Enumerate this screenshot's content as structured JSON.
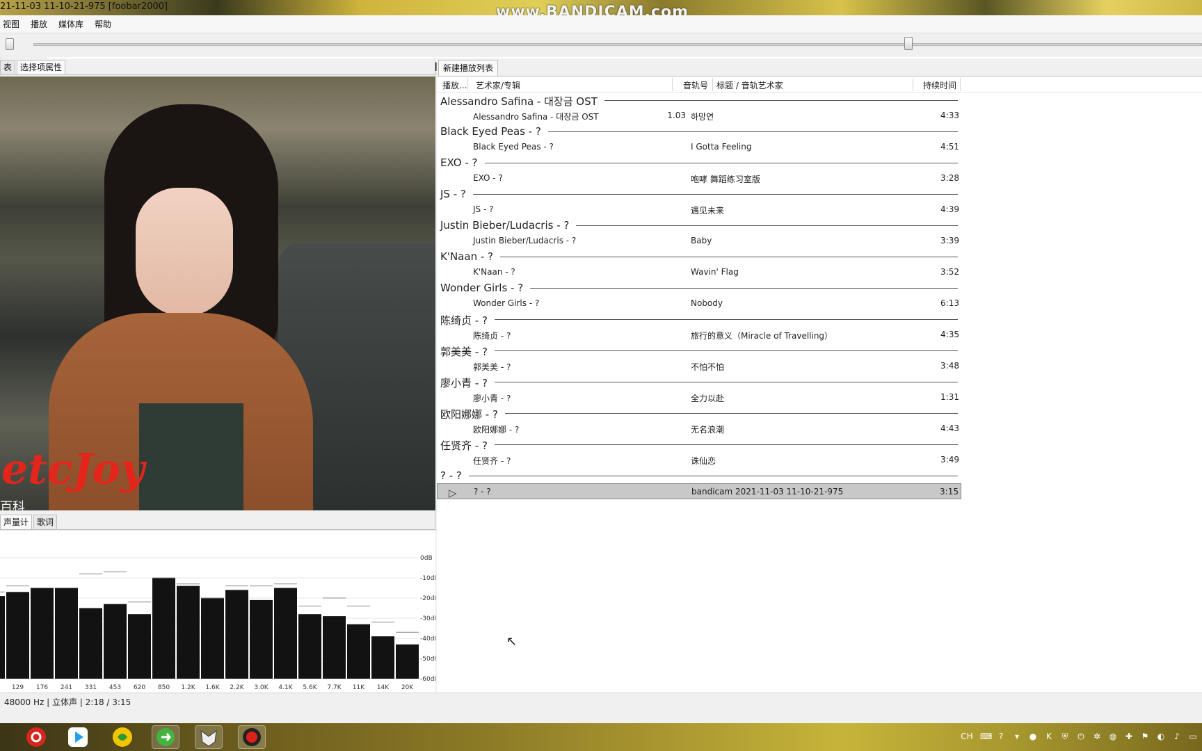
{
  "window": {
    "title": "21-11-03 11-10-21-975  [foobar2000]",
    "watermark": "www.BANDICAM.com"
  },
  "menu": [
    "视图",
    "播放",
    "媒体库",
    "帮助"
  ],
  "left_tabs": [
    "表",
    "选择项属性"
  ],
  "bottom_tabs": [
    "声量计",
    "歌词"
  ],
  "cover": {
    "logo_text": "etcJoy",
    "logo_sub": "百科"
  },
  "spectrum": {
    "db_labels": [
      "0dB",
      "-10dB",
      "-20dB",
      "-30dB",
      "-40dB",
      "-50dB",
      "-60dB"
    ],
    "freq_labels": [
      "129",
      "176",
      "241",
      "331",
      "453",
      "620",
      "850",
      "1.2K",
      "1.6K",
      "2.2K",
      "3.0K",
      "4.1K",
      "5.6K",
      "7.7K",
      "11K",
      "14K",
      "20K"
    ],
    "levels_db": [
      -19,
      -17,
      -15,
      -15,
      -25,
      -23,
      -28,
      -10,
      -14,
      -20,
      -16,
      -21,
      -15,
      -28,
      -29,
      -33,
      -39,
      -43
    ],
    "peaks_db": [
      -17,
      -14,
      -15,
      -15,
      -8,
      -7,
      -22,
      -10,
      -13,
      -20,
      -14,
      -14,
      -13,
      -24,
      -20,
      -24,
      -32,
      -37
    ]
  },
  "playlist": {
    "tab": "新建播放列表",
    "columns": {
      "playing": "播放...",
      "artist_album": "艺术家/专辑",
      "track_no": "音轨号",
      "title": "标题 / 音轨艺术家",
      "duration": "持续时间"
    },
    "groups": [
      {
        "header": "Alessandro Safina - 대장금 OST",
        "artist": "Alessandro Safina - 대장금 OST",
        "track": "1.03",
        "title": "하망연",
        "duration": "4:33"
      },
      {
        "header": "Black Eyed Peas - ?",
        "artist": "Black Eyed Peas - ?",
        "track": "",
        "title": "I Gotta Feeling",
        "duration": "4:51"
      },
      {
        "header": "EXO - ?",
        "artist": "EXO - ?",
        "track": "",
        "title": "咆哮 舞蹈练习室版",
        "duration": "3:28"
      },
      {
        "header": "JS - ?",
        "artist": "JS - ?",
        "track": "",
        "title": "遇见未来",
        "duration": "4:39"
      },
      {
        "header": "Justin Bieber/Ludacris - ?",
        "artist": "Justin Bieber/Ludacris - ?",
        "track": "",
        "title": "Baby",
        "duration": "3:39"
      },
      {
        "header": "K'Naan - ?",
        "artist": "K'Naan - ?",
        "track": "",
        "title": "Wavin' Flag",
        "duration": "3:52"
      },
      {
        "header": "Wonder Girls - ?",
        "artist": "Wonder Girls - ?",
        "track": "",
        "title": "Nobody",
        "duration": "6:13"
      },
      {
        "header": "陈绮贞 - ?",
        "artist": "陈绮贞 - ?",
        "track": "",
        "title": "旅行的意义（Miracle of Travelling）",
        "duration": "4:35"
      },
      {
        "header": "郭美美 - ?",
        "artist": "郭美美 - ?",
        "track": "",
        "title": "不怕不怕",
        "duration": "3:48"
      },
      {
        "header": "廖小青 - ?",
        "artist": "廖小青 - ?",
        "track": "",
        "title": "全力以赴",
        "duration": "1:31"
      },
      {
        "header": "欧阳娜娜 - ?",
        "artist": "欧阳娜娜 - ?",
        "track": "",
        "title": "无名浪潮",
        "duration": "4:43"
      },
      {
        "header": "任贤齐 - ?",
        "artist": "任贤齐 - ?",
        "track": "",
        "title": "诛仙恋",
        "duration": "3:49"
      },
      {
        "header": "? - ?",
        "artist": "? - ?",
        "track": "",
        "title": "bandicam 2021-11-03 11-10-21-975",
        "duration": "3:15",
        "playing": true
      }
    ]
  },
  "status": "48000 Hz | 立体声 | 2:18 / 3:15",
  "taskbar": {
    "apps": [
      "netease-music",
      "youku",
      "app-green-circle",
      "app-green-refresh",
      "app-fox",
      "bandicam-record"
    ],
    "tray_lang": "CH"
  }
}
